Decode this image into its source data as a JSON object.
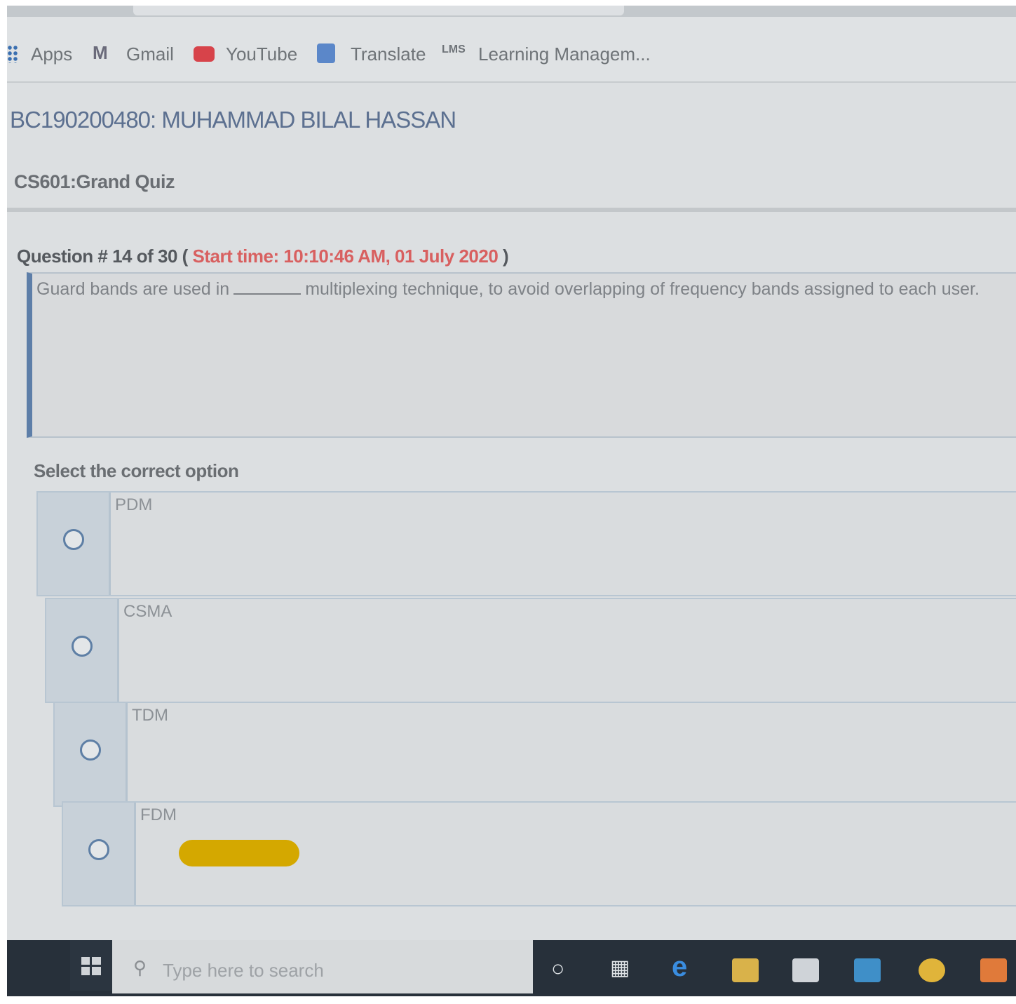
{
  "bookmarks": {
    "apps": "Apps",
    "gmail_icon": "M",
    "gmail": "Gmail",
    "youtube": "YouTube",
    "translate": "Translate",
    "lms_icon": "LMS",
    "lms": "Learning Managem..."
  },
  "student": "BC190200480: MUHAMMAD BILAL HASSAN",
  "quiz_title": "CS601:Grand Quiz",
  "question": {
    "number_label": "Question # 14 of 30 (",
    "start_label": "Start time:",
    "start_time": "10:10:46 AM, 01 July 2020",
    "close_paren": ")",
    "text_before": "Guard bands are used in",
    "text_after": "multiplexing technique, to avoid overlapping of frequency bands assigned to each user."
  },
  "select_label": "Select the correct option",
  "options": [
    "PDM",
    "CSMA",
    "TDM",
    "FDM"
  ],
  "taskbar": {
    "search_placeholder": "Type here to search"
  },
  "colors": {
    "accent_blue": "#5d7ea8",
    "start_time_red": "#d86060",
    "highlight": "#d4a800"
  }
}
